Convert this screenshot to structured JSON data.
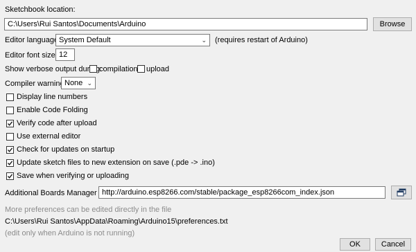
{
  "sketchbook": {
    "label": "Sketchbook location:",
    "path": "C:\\Users\\Rui Santos\\Documents\\Arduino",
    "browse_label": "Browse"
  },
  "editor_language": {
    "label": "Editor language:",
    "value": "System Default",
    "note": "(requires restart of Arduino)"
  },
  "font_size": {
    "label": "Editor font size:",
    "value": "12"
  },
  "verbose": {
    "label": "Show verbose output during:",
    "compilation": {
      "label": "compilation",
      "checked": false
    },
    "upload": {
      "label": "upload",
      "checked": false
    }
  },
  "compiler_warnings": {
    "label": "Compiler warnings:",
    "value": "None"
  },
  "options": [
    {
      "label": "Display line numbers",
      "checked": false
    },
    {
      "label": "Enable Code Folding",
      "checked": false
    },
    {
      "label": "Verify code after upload",
      "checked": true
    },
    {
      "label": "Use external editor",
      "checked": false
    },
    {
      "label": "Check for updates on startup",
      "checked": true
    },
    {
      "label": "Update sketch files to new extension on save (.pde -> .ino)",
      "checked": true
    },
    {
      "label": "Save when verifying or uploading",
      "checked": true
    }
  ],
  "boards_manager": {
    "label": "Additional Boards Manager URLs:",
    "value": "http://arduino.esp8266.com/stable/package_esp8266com_index.json"
  },
  "footer": {
    "more_prefs": "More preferences can be edited directly in the file",
    "prefs_path": "C:\\Users\\Rui Santos\\AppData\\Roaming\\Arduino15\\preferences.txt",
    "edit_note": "(edit only when Arduino is not running)"
  },
  "buttons": {
    "ok": "OK",
    "cancel": "Cancel"
  }
}
